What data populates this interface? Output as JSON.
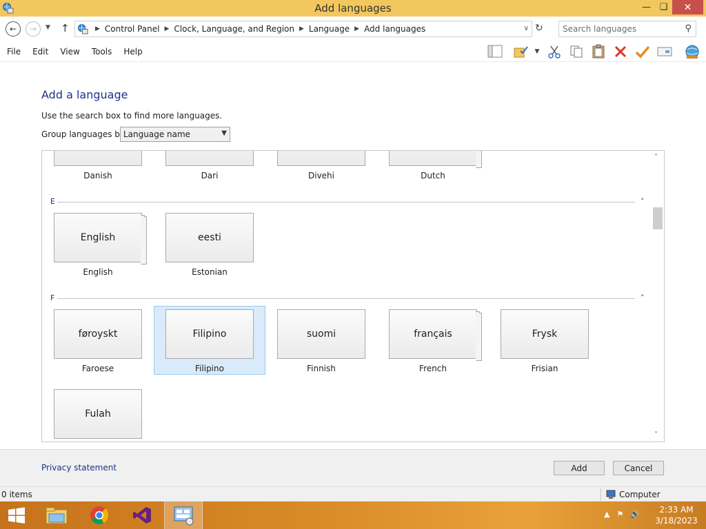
{
  "window": {
    "title": "Add languages",
    "controls": {
      "minimize": "—",
      "maximize": "❏",
      "close": "✕"
    }
  },
  "addressbar": {
    "breadcrumbs": [
      "Control Panel",
      "Clock, Language, and Region",
      "Language",
      "Add languages"
    ],
    "search_placeholder": "Search languages"
  },
  "menu": {
    "items": [
      "File",
      "Edit",
      "View",
      "Tools",
      "Help"
    ]
  },
  "toolbar": {
    "icons": [
      "layout-icon",
      "folder-check-icon",
      "cut-icon",
      "copy-icon",
      "paste-icon",
      "delete-icon",
      "checkmark-icon",
      "properties-icon",
      "globe-icon"
    ]
  },
  "content": {
    "heading": "Add a language",
    "hint": "Use the search box to find more languages.",
    "group_by_label": "Group languages by:",
    "group_by_value": "Language name"
  },
  "languages": {
    "partial_row": [
      {
        "caption": "Danish",
        "stacked": false
      },
      {
        "caption": "Dari",
        "stacked": false
      },
      {
        "caption": "Divehi",
        "stacked": false
      },
      {
        "caption": "Dutch",
        "stacked": true
      }
    ],
    "groups": [
      {
        "letter": "E",
        "items": [
          {
            "native": "English",
            "caption": "English",
            "stacked": true
          },
          {
            "native": "eesti",
            "caption": "Estonian",
            "stacked": false
          }
        ]
      },
      {
        "letter": "F",
        "items": [
          {
            "native": "føroyskt",
            "caption": "Faroese",
            "stacked": false
          },
          {
            "native": "Filipino",
            "caption": "Filipino",
            "stacked": false,
            "selected": true
          },
          {
            "native": "suomi",
            "caption": "Finnish",
            "stacked": false
          },
          {
            "native": "français",
            "caption": "French",
            "stacked": true
          },
          {
            "native": "Frysk",
            "caption": "Frisian",
            "stacked": false
          },
          {
            "native": "Fulah",
            "caption": "",
            "stacked": false
          }
        ]
      }
    ],
    "collapse_glyph": "˄"
  },
  "footer": {
    "privacy": "Privacy statement",
    "add_label": "Add",
    "cancel_label": "Cancel"
  },
  "statusbar": {
    "items_count": "0 items",
    "location": "Computer"
  },
  "taskbar": {
    "time": "2:33 AM",
    "date": "3/18/2023"
  }
}
